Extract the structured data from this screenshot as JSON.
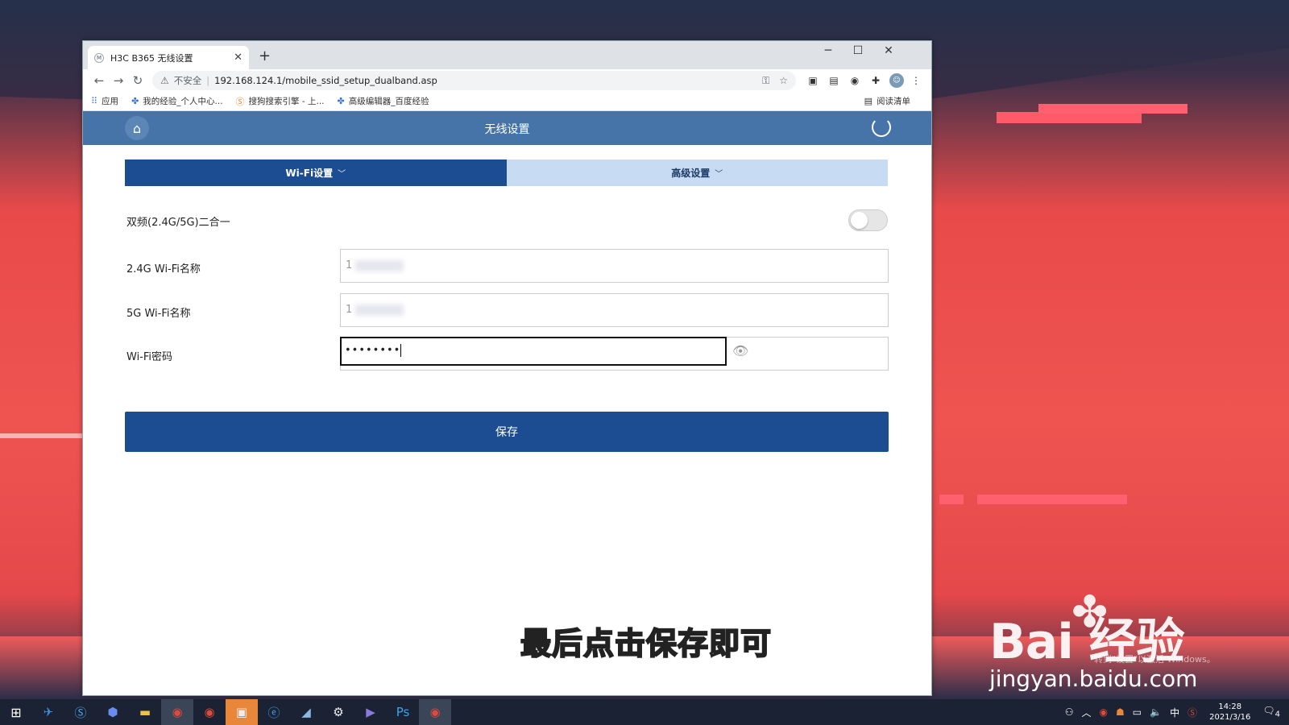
{
  "browser": {
    "tab_title": "H3C B365 无线设置",
    "tab_favicon": "M",
    "url": "192.168.124.1/mobile_ssid_setup_dualband.asp",
    "security_label": "不安全",
    "bookmarks": [
      {
        "icon": "apps-icon",
        "label": "应用"
      },
      {
        "icon": "paw-icon",
        "label": "我的经验_个人中心..."
      },
      {
        "icon": "sogou-icon",
        "label": "搜狗搜索引擎 - 上..."
      },
      {
        "icon": "paw-icon",
        "label": "高级编辑器_百度经验"
      }
    ],
    "reading_list": "阅读清单"
  },
  "router": {
    "header_title": "无线设置",
    "tabs": [
      {
        "label": "Wi-Fi设置",
        "active": true
      },
      {
        "label": "高级设置",
        "active": false
      }
    ],
    "dualband_label": "双频(2.4G/5G)二合一",
    "dualband_enabled": false,
    "ssid24_label": "2.4G Wi-Fi名称",
    "ssid5_label": "5G Wi-Fi名称",
    "ssid24_value": "1",
    "ssid5_value": "1",
    "password_label": "Wi-Fi密码",
    "password_value": "••••••••",
    "save_label": "保存"
  },
  "overlay": {
    "subtitle": "最后点击保存即可",
    "watermark_logo": "Bai   经验",
    "watermark_url": "jingyan.baidu.com",
    "activate_text": "转到\"设置\"以激活 Windows。"
  },
  "taskbar": {
    "time": "14:28",
    "date": "2021/3/16",
    "ime": "中",
    "notifications": "4"
  },
  "colors": {
    "header_blue": "#4674a8",
    "primary_blue": "#1c4d92",
    "tab_inactive": "#c7dcf3"
  }
}
